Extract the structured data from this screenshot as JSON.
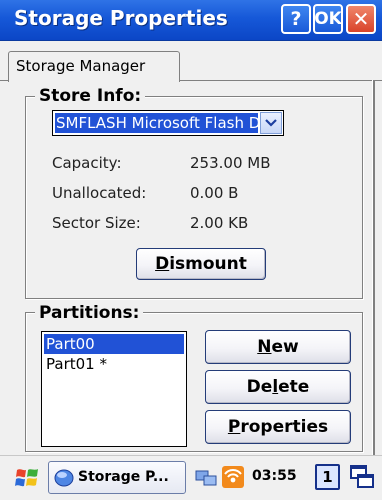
{
  "window": {
    "title": "Storage Properties",
    "help_label": "?",
    "ok_label": "OK",
    "close_label": "✕"
  },
  "tabs": [
    {
      "label": "Storage Manager",
      "selected": true
    }
  ],
  "store_info": {
    "group_label": "Store Info:",
    "selected_store": "SMFLASH Microsoft Flash Disk",
    "rows": [
      {
        "label": "Capacity:",
        "value": "253.00 MB"
      },
      {
        "label": "Unallocated:",
        "value": "0.00 B"
      },
      {
        "label": "Sector Size:",
        "value": "2.00 KB"
      }
    ],
    "dismount_prefix": "",
    "dismount_underlined": "D",
    "dismount_rest": "ismount"
  },
  "partitions": {
    "group_label": "Partitions:",
    "items": [
      {
        "label": "Part00",
        "selected": true
      },
      {
        "label": "Part01 *",
        "selected": false
      }
    ],
    "new_button": {
      "prefix": "",
      "underlined": "N",
      "rest": "ew"
    },
    "delete_button": {
      "prefix": "De",
      "underlined": "l",
      "rest": "ete"
    },
    "properties_button": {
      "prefix": "",
      "underlined": "P",
      "rest": "roperties"
    }
  },
  "taskbar": {
    "task_label": "Storage P...",
    "clock": "03:55",
    "desktop_number": "1",
    "icons": [
      "start-flag-icon",
      "storage-app-icon",
      "network-icon",
      "wifi-icon",
      "windows-icon"
    ]
  },
  "colors": {
    "titlebar": "#1658d8",
    "selection": "#2152d6",
    "close_button": "#d9432a"
  }
}
